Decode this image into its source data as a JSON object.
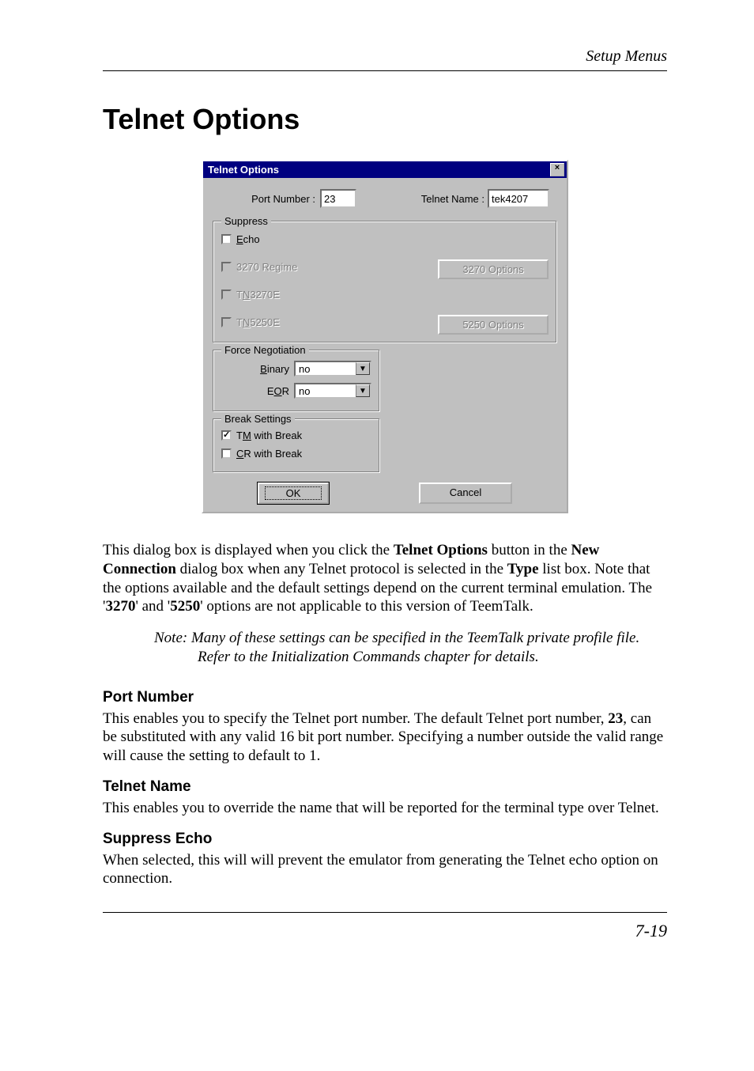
{
  "header": "Setup Menus",
  "title": "Telnet Options",
  "dialog": {
    "title": "Telnet Options",
    "close": "×",
    "port_label": "Port Number :",
    "port_value": "23",
    "name_label": "Telnet Name :",
    "name_value": "tek4207",
    "suppress": {
      "legend": "Suppress",
      "echo_u": "E",
      "echo_rest": "cho",
      "r3270": "3270 Regime",
      "tn3270e_pre": "T",
      "tn3270e_u": "N",
      "tn3270e_post": "3270E",
      "tn5250e_pre": "T",
      "tn5250e_u": "N",
      "tn5250e_post": "5250E",
      "btn3270": "3270 Options",
      "btn5250": "5250 Options"
    },
    "force": {
      "legend": "Force Negotiation",
      "binary_u": "B",
      "binary_rest": "inary",
      "binary_val": "no",
      "eor_pre": "E",
      "eor_u": "O",
      "eor_post": "R",
      "eor_val": "no"
    },
    "brk": {
      "legend": "Break Settings",
      "tm_pre": "T",
      "tm_u": "M",
      "tm_post": " with Break",
      "cr_u": "C",
      "cr_post": "R with Break"
    },
    "ok": "OK",
    "cancel": "Cancel"
  },
  "para1_a": "This dialog box is displayed when you click the ",
  "para1_b": "Telnet Options",
  "para1_c": " button in the ",
  "para1_d": "New Connection",
  "para1_e": " dialog box when any Telnet protocol is selected in the ",
  "para1_f": "Type",
  "para1_g": " list box. Note that the options available and the default settings depend on the current terminal emulation. The '",
  "para1_h": "3270",
  "para1_i": "' and '",
  "para1_j": "5250",
  "para1_k": "' options are not applicable to this version of TeemTalk.",
  "note_label": "Note:  ",
  "note_text": "Many of these settings can be specified in the TeemTalk private profile file. Refer to the Initialization Commands chapter for details.",
  "sec1_h": "Port Number",
  "sec1_a": "This enables you to specify the Telnet port number. The default Telnet port number, ",
  "sec1_b": "23",
  "sec1_c": ", can be substituted with any valid 16 bit port number. Specifying a number outside the valid range will cause the setting to default to 1.",
  "sec2_h": "Telnet Name",
  "sec2_t": "This enables you to override the name that will be reported for the terminal type over Telnet.",
  "sec3_h": "Suppress Echo",
  "sec3_t": "When selected, this will will prevent the emulator from generating the Telnet echo option on connection.",
  "page_no": "7-19"
}
